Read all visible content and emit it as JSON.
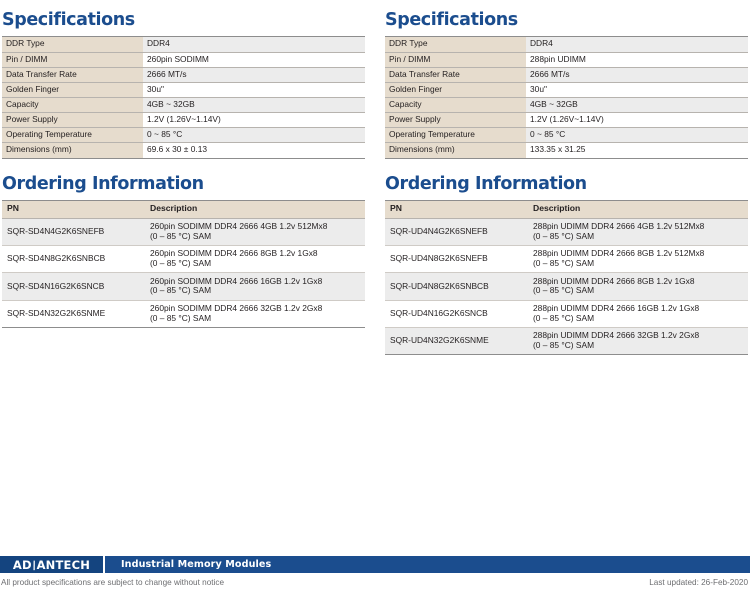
{
  "left": {
    "spec": {
      "title": "Specifications",
      "rows": [
        {
          "key": "DDR Type",
          "value": "DDR4"
        },
        {
          "key": "Pin / DIMM",
          "value": "260pin SODIMM"
        },
        {
          "key": "Data Transfer Rate",
          "value": "2666 MT/s"
        },
        {
          "key": "Golden Finger",
          "value": "30u\""
        },
        {
          "key": "Capacity",
          "value": "4GB ~ 32GB"
        },
        {
          "key": "Power Supply",
          "value": "1.2V (1.26V~1.14V)"
        },
        {
          "key": "Operating Temperature",
          "value": "0 ~ 85 °C"
        },
        {
          "key": "Dimensions (mm)",
          "value": "69.6 x 30 ± 0.13"
        }
      ]
    },
    "ordering": {
      "title": "Ordering Information",
      "headers": {
        "pn": "PN",
        "description": "Description"
      },
      "rows": [
        {
          "pn": "SQR-SD4N4G2K6SNEFB",
          "desc1": "260pin SODIMM DDR4 2666 4GB 1.2v 512Mx8",
          "desc2": "(0 – 85 °C) SAM"
        },
        {
          "pn": "SQR-SD4N8G2K6SNBCB",
          "desc1": "260pin SODIMM DDR4 2666 8GB 1.2v 1Gx8",
          "desc2": "(0 – 85 °C) SAM"
        },
        {
          "pn": "SQR-SD4N16G2K6SNCB",
          "desc1": "260pin SODIMM DDR4 2666 16GB 1.2v 1Gx8",
          "desc2": "(0 – 85 °C) SAM"
        },
        {
          "pn": "SQR-SD4N32G2K6SNME",
          "desc1": "260pin SODIMM DDR4 2666 32GB 1.2v 2Gx8",
          "desc2": "(0 – 85 °C) SAM"
        }
      ]
    }
  },
  "right": {
    "spec": {
      "title": "Specifications",
      "rows": [
        {
          "key": "DDR Type",
          "value": "DDR4"
        },
        {
          "key": "Pin / DIMM",
          "value": "288pin UDIMM"
        },
        {
          "key": "Data Transfer Rate",
          "value": "2666 MT/s"
        },
        {
          "key": "Golden Finger",
          "value": "30u\""
        },
        {
          "key": "Capacity",
          "value": "4GB ~ 32GB"
        },
        {
          "key": "Power Supply",
          "value": "1.2V (1.26V~1.14V)"
        },
        {
          "key": "Operating Temperature",
          "value": "0 ~ 85 °C"
        },
        {
          "key": "Dimensions (mm)",
          "value": "133.35 x 31.25"
        }
      ]
    },
    "ordering": {
      "title": "Ordering Information",
      "headers": {
        "pn": "PN",
        "description": "Description"
      },
      "rows": [
        {
          "pn": "SQR-UD4N4G2K6SNEFB",
          "desc1": "288pin UDIMM DDR4 2666 4GB 1.2v 512Mx8",
          "desc2": "(0 – 85 °C) SAM"
        },
        {
          "pn": "SQR-UD4N8G2K6SNEFB",
          "desc1": "288pin UDIMM DDR4 2666 8GB 1.2v 512Mx8",
          "desc2": "(0 – 85 °C) SAM"
        },
        {
          "pn": "SQR-UD4N8G2K6SNBCB",
          "desc1": "288pin  UDIMM DDR4 2666 8GB 1.2v 1Gx8",
          "desc2": "(0 – 85 °C) SAM"
        },
        {
          "pn": "SQR-UD4N16G2K6SNCB",
          "desc1": "288pin UDIMM DDR4 2666 16GB 1.2v 1Gx8",
          "desc2": "(0 – 85 °C) SAM"
        },
        {
          "pn": "SQR-UD4N32G2K6SNME",
          "desc1": "288pin UDIMM DDR4 2666 32GB 1.2v 2Gx8",
          "desc2": "(0 – 85 °C) SAM"
        }
      ]
    }
  },
  "footer": {
    "brand_part1": "AD",
    "brand_slash": "\\",
    "brand_part2": "ANTECH",
    "tagline": "Industrial Memory Modules",
    "disclaimer": "All product specifications are subject to change without notice",
    "last_updated": "Last updated: 26-Feb-2020"
  },
  "colors": {
    "heading_blue": "#1b4d8e",
    "footer_blue": "#1b4d8e",
    "brand_blue": "#14447f",
    "table_key_bg": "#e6dccd",
    "table_alt_bg": "#ececec",
    "rule": "#8d8d8d",
    "note_text": "#6d6e71"
  }
}
